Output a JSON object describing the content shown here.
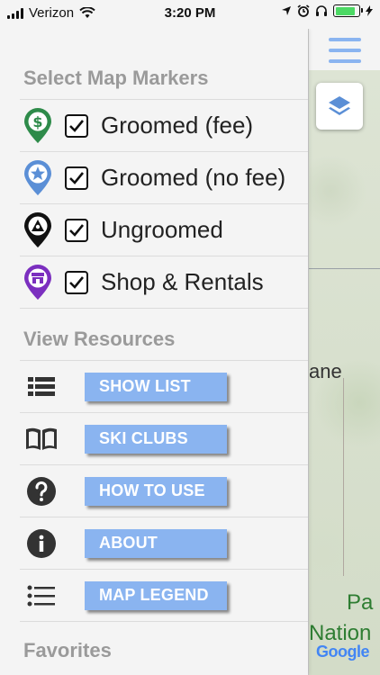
{
  "status_bar": {
    "carrier": "Verizon",
    "time": "3:20 PM",
    "battery_level": 0.85
  },
  "drawer": {
    "markers": {
      "title": "Select Map Markers",
      "items": [
        {
          "label": "Groomed (fee)",
          "checked": true,
          "icon": "dollar-marker-icon",
          "color": "#2e8b4a"
        },
        {
          "label": "Groomed (no fee)",
          "checked": true,
          "icon": "star-marker-icon",
          "color": "#5b8fd6"
        },
        {
          "label": "Ungroomed",
          "checked": true,
          "icon": "triangle-marker-icon",
          "color": "#111111"
        },
        {
          "label": "Shop & Rentals",
          "checked": true,
          "icon": "shop-marker-icon",
          "color": "#7b2fbf"
        }
      ]
    },
    "resources": {
      "title": "View Resources",
      "items": [
        {
          "label": "SHOW LIST",
          "icon": "list-icon"
        },
        {
          "label": "SKI CLUBS",
          "icon": "book-icon"
        },
        {
          "label": "HOW TO USE",
          "icon": "question-icon"
        },
        {
          "label": "ABOUT",
          "icon": "info-icon"
        },
        {
          "label": "MAP LEGEND",
          "icon": "legend-list-icon"
        }
      ]
    },
    "favorites": {
      "title": "Favorites"
    }
  },
  "map": {
    "labels": [
      "ane",
      "Pa",
      "Nation"
    ],
    "attribution": "Google"
  },
  "colors": {
    "accent_button": "#8ab4f0",
    "section_title": "#9a9a9a"
  }
}
